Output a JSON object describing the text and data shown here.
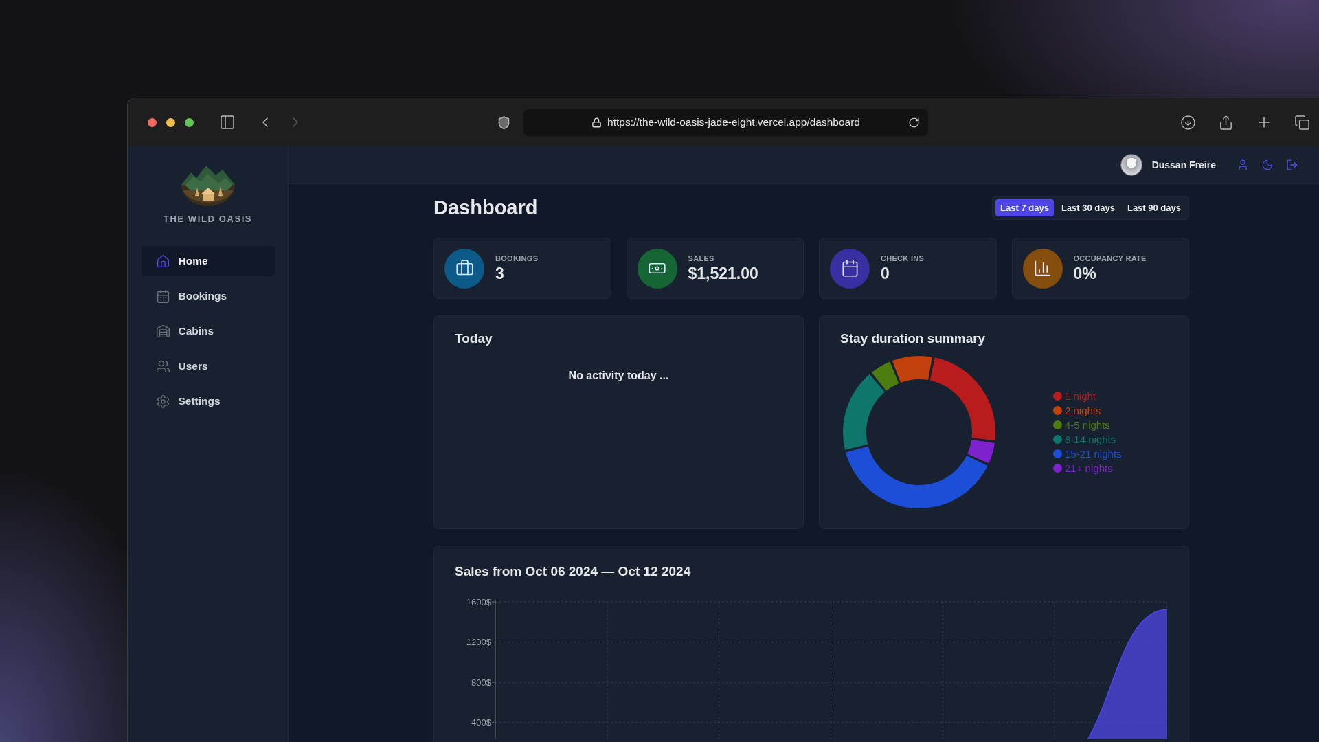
{
  "browser": {
    "url": "https://the-wild-oasis-jade-eight.vercel.app/dashboard"
  },
  "sidebar": {
    "brand": "THE WILD OASIS",
    "items": [
      {
        "label": "Home",
        "selected": true
      },
      {
        "label": "Bookings",
        "selected": false
      },
      {
        "label": "Cabins",
        "selected": false
      },
      {
        "label": "Users",
        "selected": false
      },
      {
        "label": "Settings",
        "selected": false
      }
    ]
  },
  "header": {
    "user_name": "Dussan Freire"
  },
  "page": {
    "title": "Dashboard",
    "filters": [
      {
        "label": "Last 7 days",
        "selected": true
      },
      {
        "label": "Last 30 days",
        "selected": false
      },
      {
        "label": "Last 90 days",
        "selected": false
      }
    ]
  },
  "stats": [
    {
      "label": "BOOKINGS",
      "value": "3",
      "color": "#0c5a87"
    },
    {
      "label": "SALES",
      "value": "$1,521.00",
      "color": "#166534"
    },
    {
      "label": "CHECK INS",
      "value": "0",
      "color": "#3730a3"
    },
    {
      "label": "OCCUPANCY RATE",
      "value": "0%",
      "color": "#854d0e"
    }
  ],
  "today": {
    "title": "Today",
    "message": "No activity today ..."
  },
  "stay_duration": {
    "title": "Stay duration summary",
    "legend": [
      {
        "label": "1 night",
        "color": "#b91c1c"
      },
      {
        "label": "2 nights",
        "color": "#c2410c"
      },
      {
        "label": "4-5 nights",
        "color": "#4d7c0f"
      },
      {
        "label": "8-14 nights",
        "color": "#0f766e"
      },
      {
        "label": "15-21 nights",
        "color": "#1d4ed8"
      },
      {
        "label": "21+ nights",
        "color": "#7e22ce"
      }
    ]
  },
  "sales": {
    "title": "Sales from Oct 06 2024 — Oct 12 2024",
    "chart_data": {
      "type": "area",
      "grid": true,
      "ylim": [
        0,
        1600
      ],
      "yticks": [
        {
          "value": 400,
          "label": "400$"
        },
        {
          "value": 800,
          "label": "800$"
        },
        {
          "value": 1200,
          "label": "1200$"
        },
        {
          "value": 1600,
          "label": "1600$"
        }
      ],
      "series": [
        {
          "color": "#4f46e5",
          "values": [
            0,
            0,
            0,
            0,
            0,
            0,
            1521
          ]
        }
      ]
    }
  }
}
